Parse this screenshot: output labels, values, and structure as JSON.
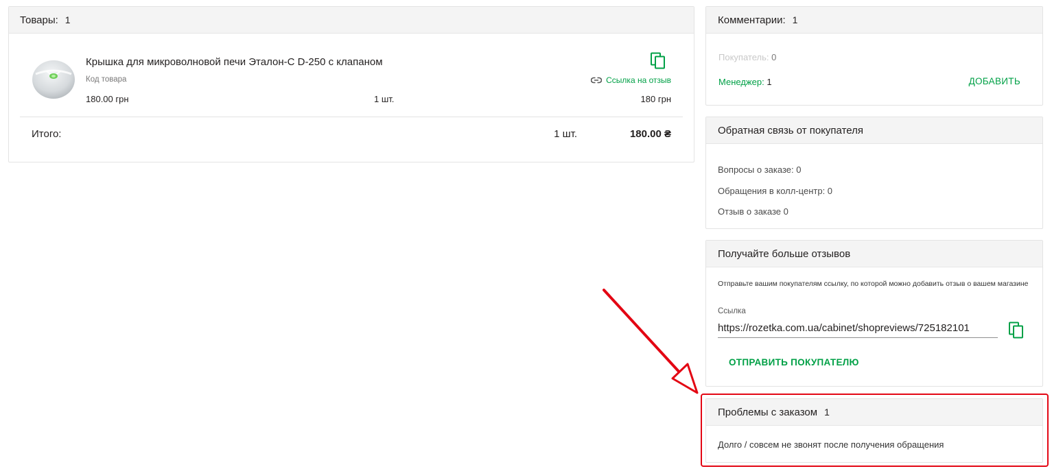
{
  "goods": {
    "title": "Товары:",
    "count": "1",
    "product": {
      "name": "Крышка для микроволновой печи Эталон-С D-250 с клапаном",
      "code_label": "Код товара",
      "price": "180.00 грн",
      "quantity": "1 шт.",
      "sum": "180 грн",
      "review_link_label": "Ссылка на отзыв"
    },
    "total": {
      "label": "Итого:",
      "quantity": "1 шт.",
      "sum": "180.00 ₴"
    }
  },
  "comments": {
    "title": "Комментарии:",
    "count": "1",
    "buyer_label": "Покупатель:",
    "buyer_count": "0",
    "manager_label": "Менеджер:",
    "manager_count": "1",
    "add_label": "ДОБАВИТЬ"
  },
  "feedback": {
    "title": "Обратная связь от покупателя",
    "questions": "Вопросы о заказе: 0",
    "callcenter": "Обращения в колл-центр: 0",
    "review": "Отзыв о заказе 0"
  },
  "more_reviews": {
    "title": "Получайте больше отзывов",
    "description": "Отправьте вашим покупателям ссылку, по которой можно добавить отзыв о вашем магазине",
    "link_label": "Ссылка",
    "link_value": "https://rozetka.com.ua/cabinet/shopreviews/725182101",
    "send_label": "ОТПРАВИТЬ ПОКУПАТЕЛЮ"
  },
  "problems": {
    "title": "Проблемы с заказом",
    "count": "1",
    "item": "Долго / совсем не звонят после получения обращения"
  },
  "icons": {
    "copy": "copy-icon",
    "link": "link-icon",
    "product": "product-image",
    "arrow": "annotation-arrow"
  },
  "colors": {
    "accent": "#00a046",
    "highlight": "#e30613",
    "header_bg": "#f4f4f4"
  }
}
